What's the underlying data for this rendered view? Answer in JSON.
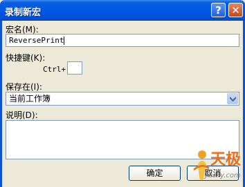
{
  "dialog": {
    "title": "录制新宏",
    "help_label": "?",
    "close_label": "✕"
  },
  "form": {
    "macro_name_label": "宏名(M):",
    "macro_name_value": "ReversePrint",
    "shortcut_label": "快捷键(K):",
    "ctrl_prefix": "Ctrl+",
    "shortcut_value": "",
    "store_in_label": "保存在(I):",
    "store_in_value": "当前工作簿",
    "description_label": "说明(D):",
    "description_value": ""
  },
  "buttons": {
    "ok": "确定",
    "cancel": "取消"
  },
  "watermark": {
    "brand": "天极",
    "url": "yesky.com"
  }
}
